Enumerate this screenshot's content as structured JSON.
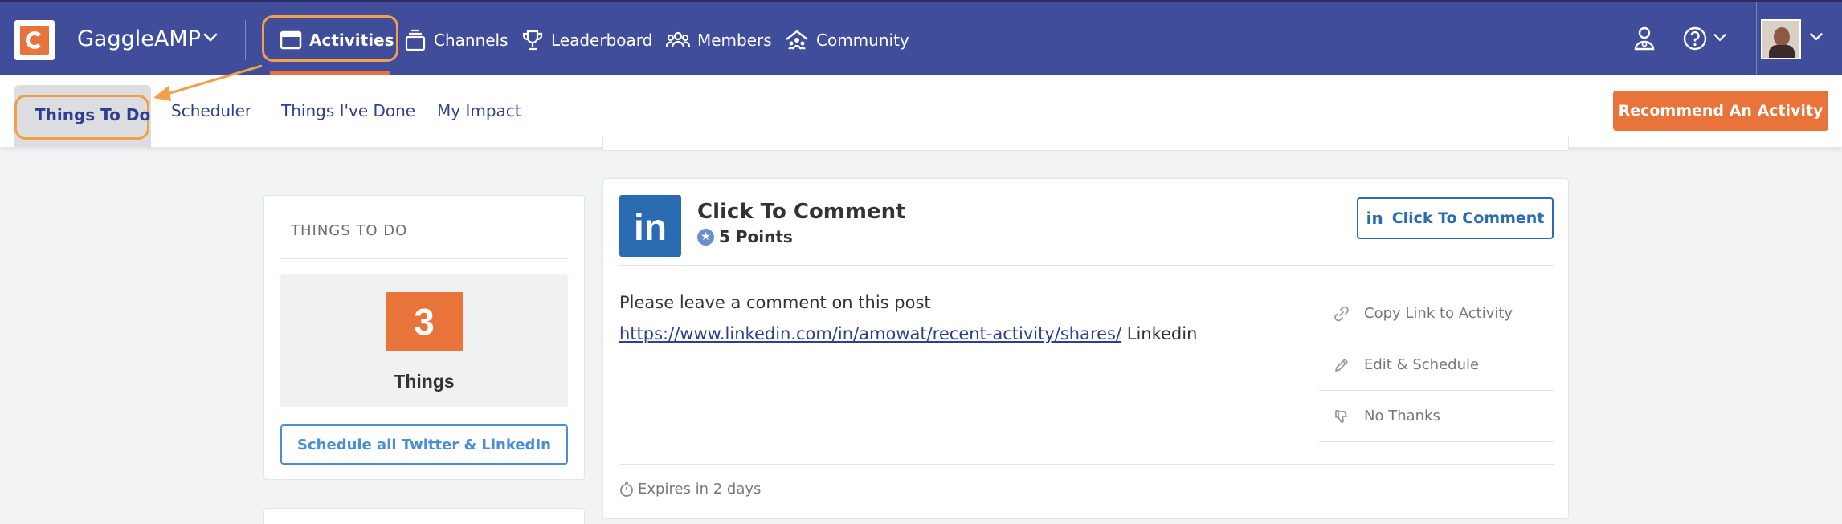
{
  "brand": {
    "name": "GaggleAMP"
  },
  "topnav": {
    "items": [
      {
        "label": "Activities",
        "icon": "activities-icon",
        "active": true
      },
      {
        "label": "Channels",
        "icon": "channels-icon"
      },
      {
        "label": "Leaderboard",
        "icon": "trophy-icon"
      },
      {
        "label": "Members",
        "icon": "members-icon"
      },
      {
        "label": "Community",
        "icon": "community-icon"
      }
    ]
  },
  "subnav": {
    "items": [
      {
        "label": "Things To Do",
        "active": true
      },
      {
        "label": "Scheduler"
      },
      {
        "label": "Things I've Done"
      },
      {
        "label": "My Impact"
      }
    ],
    "recommend_label": "Recommend An Activity"
  },
  "summary": {
    "header": "THINGS TO DO",
    "count": "3",
    "count_label": "Things",
    "schedule_label": "Schedule all Twitter & LinkedIn"
  },
  "activity": {
    "network_icon": "in",
    "title": "Click To Comment",
    "points": "5 Points",
    "action_label": "Click To Comment",
    "description": "Please leave a comment on this post",
    "link": "https://www.linkedin.com/in/amowat/recent-activity/shares/",
    "link_suffix": " Linkedin",
    "side_actions": [
      {
        "label": "Copy Link to Activity",
        "icon": "link-icon"
      },
      {
        "label": "Edit & Schedule",
        "icon": "pencil-icon"
      },
      {
        "label": "No Thanks",
        "icon": "thumbs-down-icon"
      }
    ],
    "expires": "Expires in 2 days"
  },
  "colors": {
    "nav_bg": "#3f4d9a",
    "accent": "#e8743b",
    "highlight_ring": "#f0a04b",
    "linkedin": "#2a6bb1",
    "link_blue": "#4a8fd6"
  }
}
